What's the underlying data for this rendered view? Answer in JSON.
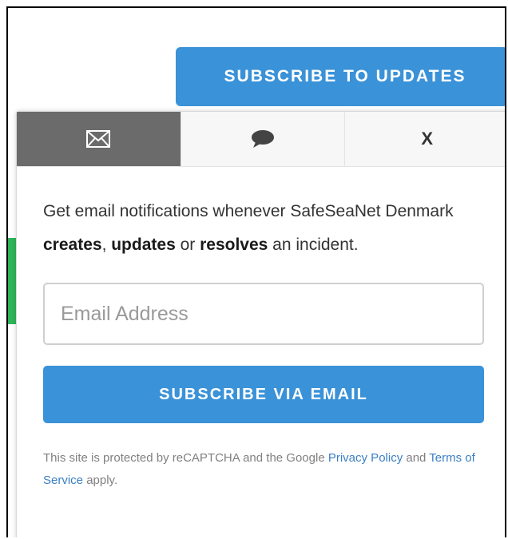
{
  "header": {
    "subscribe_label": "SUBSCRIBE TO UPDATES"
  },
  "popup": {
    "tabs": [
      {
        "name": "email",
        "icon": "envelope-icon",
        "active": true
      },
      {
        "name": "sms",
        "icon": "speech-bubble-icon",
        "active": false
      },
      {
        "name": "close",
        "label": "X",
        "active": false
      }
    ],
    "description": {
      "part1": "Get email notifications whenever SafeSeaNet Denmark ",
      "bold1": "creates",
      "part2": ", ",
      "bold2": "updates",
      "part3": " or ",
      "bold3": "resolves",
      "part4": " an incident."
    },
    "email_input": {
      "placeholder": "Email Address",
      "value": ""
    },
    "subscribe_email_label": "SUBSCRIBE VIA EMAIL",
    "recaptcha": {
      "text1": "This site is protected by reCAPTCHA and the Google ",
      "privacy_link": "Privacy Policy",
      "text2": " and ",
      "terms_link": "Terms of Service",
      "text3": " apply."
    }
  },
  "colors": {
    "accent": "#3a92d8",
    "active_tab": "#6b6b6b",
    "status_green": "#2fb45a"
  }
}
